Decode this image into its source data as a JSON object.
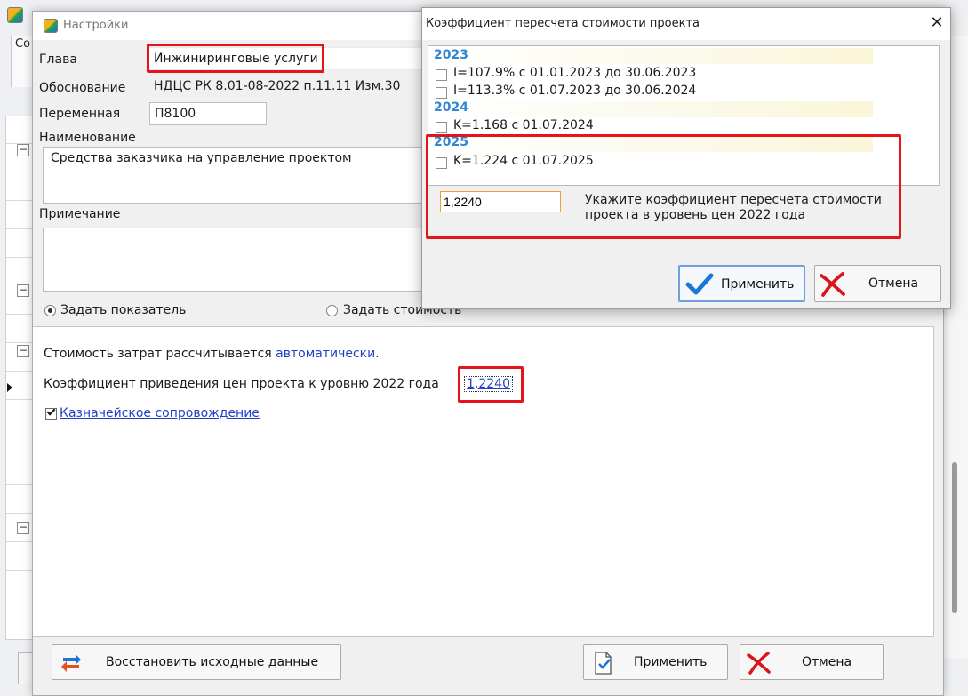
{
  "background": {
    "tab_label": "Со"
  },
  "settings": {
    "title": "Настройки",
    "labels": {
      "chapter": "Глава",
      "basis": "Обоснование",
      "variable": "Переменная",
      "name": "Наименование",
      "note": "Примечание"
    },
    "values": {
      "chapter": "Инжиниринговые услуги",
      "basis": "НДЦС РК 8.01-08-2022 п.11.11 Изм.30",
      "variable": "П8100",
      "name": "Средства заказчика на управление проектом",
      "note": ""
    },
    "radios": {
      "set_indicator": "Задать показатель",
      "set_cost": "Задать стоимость"
    },
    "panel": {
      "cost_text": "Стоимость затрат рассчитывается",
      "cost_link": "автоматически",
      "cost_dot": ".",
      "coef_label": "Коэффициент приведения цен проекта к уровню 2022 года",
      "coef_value": "1,2240",
      "treasury_label": "Казначейское сопровождение"
    },
    "buttons": {
      "restore": "Восстановить исходные данные",
      "apply": "Применить",
      "cancel": "Отмена"
    }
  },
  "coef_dialog": {
    "title": "Коэффициент пересчета стоимости проекта",
    "close": "✕",
    "groups": [
      {
        "year": "2023",
        "items": [
          "I=107.9% с 01.01.2023 до 30.06.2023",
          "I=113.3% с 01.07.2023 до 30.06.2024"
        ]
      },
      {
        "year": "2024",
        "items": [
          "K=1.168 с 01.07.2024"
        ]
      },
      {
        "year": "2025",
        "items": [
          "K=1.224 с 01.07.2025"
        ]
      }
    ],
    "input_value": "1,2240",
    "hint": "Укажите коэффициент пересчета стоимости проекта в уровень цен 2022 года",
    "buttons": {
      "apply": "Применить",
      "cancel": "Отмена"
    }
  },
  "colors": {
    "highlight": "#e4141b",
    "link": "#1f3fc7",
    "year": "#2f86d6",
    "input_border": "#f0a030",
    "check_blue": "#1a78d4",
    "cancel_red": "#d8151d"
  }
}
